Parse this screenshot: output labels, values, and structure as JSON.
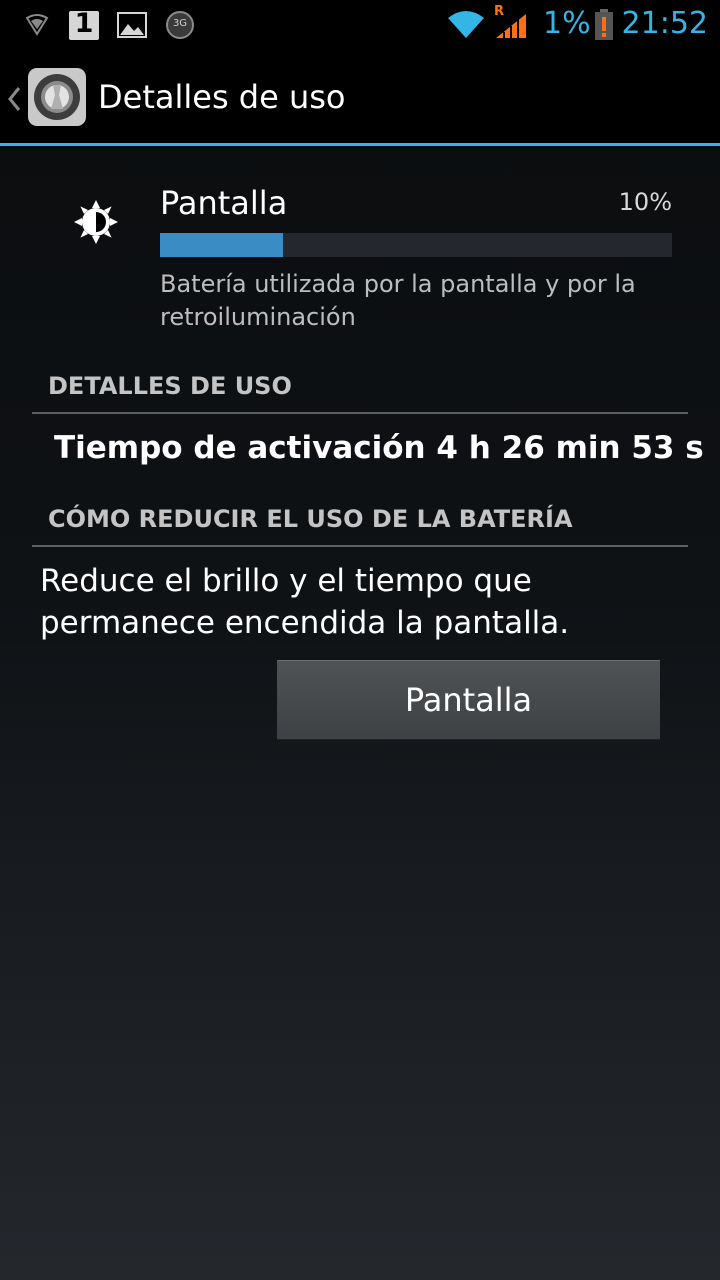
{
  "status_bar": {
    "notification_badge": "1",
    "network_badge": "3G",
    "roaming_indicator": "R",
    "battery_percent": "1%",
    "time": "21:52",
    "icons": [
      "shield-icon",
      "notification-count-icon",
      "image-icon",
      "3g-icon",
      "wifi-icon",
      "signal-icon",
      "battery-alert-icon"
    ]
  },
  "action_bar": {
    "title": "Detalles de uso",
    "icons": [
      "back-chevron-icon",
      "settings-app-icon"
    ]
  },
  "usage_item": {
    "icon": "brightness-icon",
    "title": "Pantalla",
    "percent_label": "10%",
    "percent_value": 0.1,
    "description": "Batería utilizada por la pantalla y por la retroiluminación"
  },
  "details_section": {
    "header": "DETALLES DE USO",
    "uptime": "Tiempo de activación 4 h 26 min 53 s"
  },
  "tips_section": {
    "header": "CÓMO REDUCIR EL USO DE LA BATERÍA",
    "tip": "Reduce el brillo y el tiempo que permanece encendida la pantalla.",
    "button_label": "Pantalla"
  },
  "colors": {
    "accent": "#33b5e5",
    "progress_fill": "#3a8cc4",
    "roaming": "#ff6f1a",
    "battery_alert": "#ff6f1a"
  }
}
